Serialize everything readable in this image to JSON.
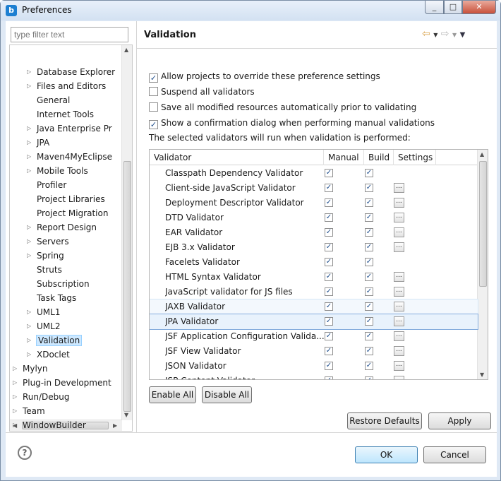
{
  "window": {
    "title": "Preferences",
    "app_icon": "b"
  },
  "filter": {
    "placeholder": "type filter text"
  },
  "tree": {
    "items": [
      {
        "label": "Database Explorer",
        "arrow": "▷"
      },
      {
        "label": "Files and Editors",
        "arrow": "▷"
      },
      {
        "label": "General",
        "arrow": ""
      },
      {
        "label": "Internet Tools",
        "arrow": ""
      },
      {
        "label": "Java Enterprise Pr",
        "arrow": "▷"
      },
      {
        "label": "JPA",
        "arrow": "▷"
      },
      {
        "label": "Maven4MyEclipse",
        "arrow": "▷"
      },
      {
        "label": "Mobile Tools",
        "arrow": "▷"
      },
      {
        "label": "Profiler",
        "arrow": ""
      },
      {
        "label": "Project Libraries",
        "arrow": ""
      },
      {
        "label": "Project Migration",
        "arrow": ""
      },
      {
        "label": "Report Design",
        "arrow": "▷"
      },
      {
        "label": "Servers",
        "arrow": "▷"
      },
      {
        "label": "Spring",
        "arrow": "▷"
      },
      {
        "label": "Struts",
        "arrow": ""
      },
      {
        "label": "Subscription",
        "arrow": ""
      },
      {
        "label": "Task Tags",
        "arrow": ""
      },
      {
        "label": "UML1",
        "arrow": "▷"
      },
      {
        "label": "UML2",
        "arrow": "▷"
      },
      {
        "label": "Validation",
        "arrow": "▷",
        "selected": true
      },
      {
        "label": "XDoclet",
        "arrow": "▷"
      },
      {
        "label": "Mylyn",
        "arrow": "▷"
      },
      {
        "label": "Plug-in Development",
        "arrow": "▷"
      },
      {
        "label": "Run/Debug",
        "arrow": "▷"
      },
      {
        "label": "Team",
        "arrow": "▷"
      },
      {
        "label": "WindowBuilder",
        "arrow": "▷"
      }
    ]
  },
  "page": {
    "title": "Validation",
    "options": [
      {
        "label": "Allow projects to override these preference settings",
        "checked": true
      },
      {
        "label": "Suspend all validators",
        "checked": false
      },
      {
        "label": "Save all modified resources automatically prior to validating",
        "checked": false
      },
      {
        "label": "Show a confirmation dialog when performing manual validations",
        "checked": true
      }
    ],
    "note": "The selected validators will run when validation is performed:"
  },
  "table": {
    "columns": [
      "Validator",
      "Manual",
      "Build",
      "Settings"
    ],
    "rows": [
      {
        "name": "Classpath Dependency Validator",
        "manual": true,
        "build": true,
        "settings": false
      },
      {
        "name": "Client-side JavaScript Validator",
        "manual": true,
        "build": true,
        "settings": true
      },
      {
        "name": "Deployment Descriptor Validator",
        "manual": true,
        "build": true,
        "settings": true
      },
      {
        "name": "DTD Validator",
        "manual": true,
        "build": true,
        "settings": true
      },
      {
        "name": "EAR Validator",
        "manual": true,
        "build": true,
        "settings": true
      },
      {
        "name": "EJB 3.x Validator",
        "manual": true,
        "build": true,
        "settings": true
      },
      {
        "name": "Facelets Validator",
        "manual": true,
        "build": true,
        "settings": false
      },
      {
        "name": "HTML Syntax Validator",
        "manual": true,
        "build": true,
        "settings": true
      },
      {
        "name": "JavaScript validator for JS files",
        "manual": true,
        "build": true,
        "settings": true
      },
      {
        "name": "JAXB Validator",
        "manual": true,
        "build": true,
        "settings": true
      },
      {
        "name": "JPA Validator",
        "manual": true,
        "build": true,
        "settings": true
      },
      {
        "name": "JSF Application Configuration Valida...",
        "manual": true,
        "build": true,
        "settings": true
      },
      {
        "name": "JSF View Validator",
        "manual": true,
        "build": true,
        "settings": true
      },
      {
        "name": "JSON Validator",
        "manual": true,
        "build": true,
        "settings": true
      },
      {
        "name": "JSP Content Validator",
        "manual": true,
        "build": true,
        "settings": true
      }
    ]
  },
  "buttons": {
    "enable_all": "Enable All",
    "disable_all": "Disable All",
    "restore_defaults": "Restore Defaults",
    "apply": "Apply",
    "ok": "OK",
    "cancel": "Cancel"
  }
}
